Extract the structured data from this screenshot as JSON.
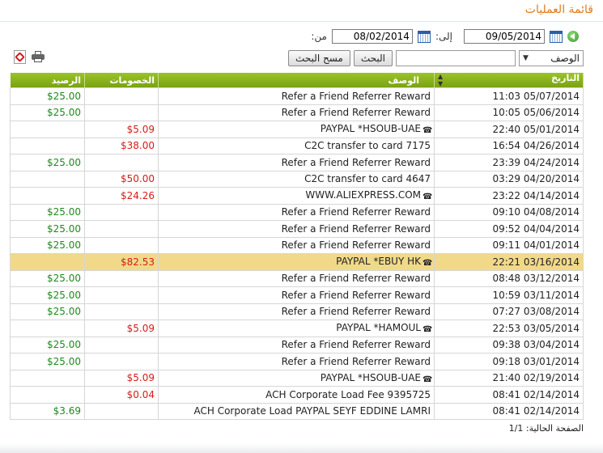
{
  "page_title": "قائمة العمليات",
  "filters": {
    "from_label": "من:",
    "from_date": "08/02/2014",
    "to_label": "إلى:",
    "to_date": "09/05/2014",
    "field_selected": "الوصف",
    "search_text": "",
    "search_button": "البحث",
    "clear_button": "مسح البحث"
  },
  "table": {
    "headers": {
      "date": "التاريخ",
      "description": "الوصف",
      "debits": "الخصومات",
      "balance": "الرصيد"
    },
    "rows": [
      {
        "date": "11:03 05/07/2014",
        "description": "Refer a Friend Referrer Reward",
        "debit": "",
        "balance": "$25.00",
        "phone": false
      },
      {
        "date": "10:05 05/06/2014",
        "description": "Refer a Friend Referrer Reward",
        "debit": "",
        "balance": "$25.00",
        "phone": false
      },
      {
        "date": "22:40 05/01/2014",
        "description": "PAYPAL *HSOUB-UAE",
        "debit": "$5.09",
        "balance": "",
        "phone": true
      },
      {
        "date": "16:54 04/26/2014",
        "description": "C2C transfer to card 7175",
        "debit": "$38.00",
        "balance": "",
        "phone": false
      },
      {
        "date": "23:39 04/24/2014",
        "description": "Refer a Friend Referrer Reward",
        "debit": "",
        "balance": "$25.00",
        "phone": false
      },
      {
        "date": "03:29 04/20/2014",
        "description": "C2C transfer to card 4647",
        "debit": "$50.00",
        "balance": "",
        "phone": false
      },
      {
        "date": "23:22 04/14/2014",
        "description": "WWW.ALIEXPRESS.COM",
        "debit": "$24.26",
        "balance": "",
        "phone": true
      },
      {
        "date": "09:10 04/08/2014",
        "description": "Refer a Friend Referrer Reward",
        "debit": "",
        "balance": "$25.00",
        "phone": false
      },
      {
        "date": "09:52 04/04/2014",
        "description": "Refer a Friend Referrer Reward",
        "debit": "",
        "balance": "$25.00",
        "phone": false
      },
      {
        "date": "09:11 04/01/2014",
        "description": "Refer a Friend Referrer Reward",
        "debit": "",
        "balance": "$25.00",
        "phone": false
      },
      {
        "date": "22:21 03/16/2014",
        "description": "PAYPAL *EBUY HK",
        "debit": "$82.53",
        "balance": "",
        "phone": true,
        "highlight": true
      },
      {
        "date": "08:48 03/12/2014",
        "description": "Refer a Friend Referrer Reward",
        "debit": "",
        "balance": "$25.00",
        "phone": false
      },
      {
        "date": "10:59 03/11/2014",
        "description": "Refer a Friend Referrer Reward",
        "debit": "",
        "balance": "$25.00",
        "phone": false
      },
      {
        "date": "07:27 03/08/2014",
        "description": "Refer a Friend Referrer Reward",
        "debit": "",
        "balance": "$25.00",
        "phone": false
      },
      {
        "date": "22:53 03/05/2014",
        "description": "PAYPAL *HAMOUL",
        "debit": "$5.09",
        "balance": "",
        "phone": true
      },
      {
        "date": "09:38 03/04/2014",
        "description": "Refer a Friend Referrer Reward",
        "debit": "",
        "balance": "$25.00",
        "phone": false
      },
      {
        "date": "09:18 03/01/2014",
        "description": "Refer a Friend Referrer Reward",
        "debit": "",
        "balance": "$25.00",
        "phone": false
      },
      {
        "date": "21:40 02/19/2014",
        "description": "PAYPAL *HSOUB-UAE",
        "debit": "$5.09",
        "balance": "",
        "phone": true
      },
      {
        "date": "08:41 02/14/2014",
        "description": "ACH Corporate Load Fee 9395725",
        "debit": "$0.04",
        "balance": "",
        "phone": false
      },
      {
        "date": "08:41 02/14/2014",
        "description": "ACH Corporate Load PAYPAL SEYF EDDINE LAMRI",
        "debit": "",
        "balance": "$3.69",
        "phone": false
      }
    ]
  },
  "pager": {
    "label": "الصفحة الحالية:",
    "value": "1/1"
  },
  "icons": {
    "pdf": "pdf-export-icon",
    "print": "print-icon",
    "calendar": "calendar-icon",
    "go": "go-back-icon",
    "phone": "phone-icon",
    "sort": "sort-arrows-icon"
  },
  "colors": {
    "header_green": "#8ab51d",
    "title_orange": "#e07b1e",
    "credit_green": "#1d8a1d",
    "debit_red": "#d81a1a",
    "highlight": "#f0da8a"
  }
}
